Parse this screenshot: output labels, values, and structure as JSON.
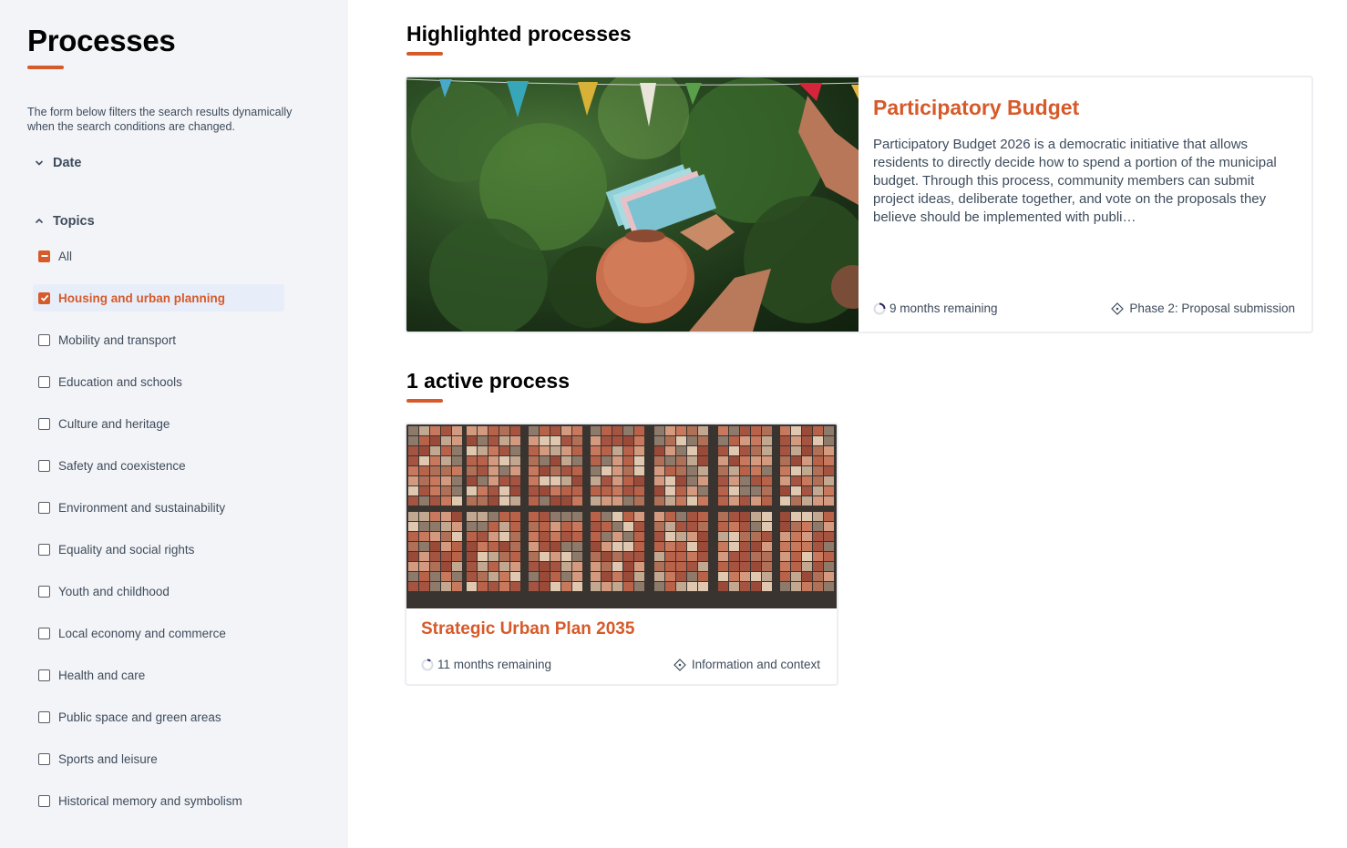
{
  "sidebar": {
    "title": "Processes",
    "description": "The form below filters the search results dynamically when the search conditions are changed.",
    "filters": {
      "date": {
        "label": "Date",
        "expanded": false
      },
      "topics": {
        "label": "Topics",
        "expanded": true,
        "items": [
          {
            "label": "All",
            "state": "indeterminate"
          },
          {
            "label": "Housing and urban planning",
            "state": "checked"
          },
          {
            "label": "Mobility and transport",
            "state": "unchecked"
          },
          {
            "label": "Education and schools",
            "state": "unchecked"
          },
          {
            "label": "Culture and heritage",
            "state": "unchecked"
          },
          {
            "label": "Safety and coexistence",
            "state": "unchecked"
          },
          {
            "label": "Environment and sustainability",
            "state": "unchecked"
          },
          {
            "label": "Equality and social rights",
            "state": "unchecked"
          },
          {
            "label": "Youth and childhood",
            "state": "unchecked"
          },
          {
            "label": "Local economy and commerce",
            "state": "unchecked"
          },
          {
            "label": "Health and care",
            "state": "unchecked"
          },
          {
            "label": "Public space and green areas",
            "state": "unchecked"
          },
          {
            "label": "Sports and leisure",
            "state": "unchecked"
          },
          {
            "label": "Historical memory and symbolism",
            "state": "unchecked"
          }
        ]
      }
    }
  },
  "main": {
    "highlighted": {
      "heading": "Highlighted processes",
      "card": {
        "title": "Participatory Budget",
        "description": "Participatory Budget 2026 is a democratic initiative that allows residents to directly decide how to spend a portion of the municipal budget. Through this process, community members can submit project ideas, deliberate together, and vote on the proposals they believe should be implemented with publi…",
        "time_remaining": "9 months remaining",
        "phase": "Phase 2: Proposal submission",
        "progress": 0.25
      }
    },
    "active": {
      "heading": "1 active process",
      "card": {
        "title": "Strategic Urban Plan 2035",
        "time_remaining": "11 months remaining",
        "phase": "Information and context",
        "progress": 0.1
      }
    }
  },
  "colors": {
    "accent": "#d65a2a",
    "sidebar_bg": "#f3f4f7",
    "text": "#3e4c5c",
    "heading": "#020203"
  }
}
